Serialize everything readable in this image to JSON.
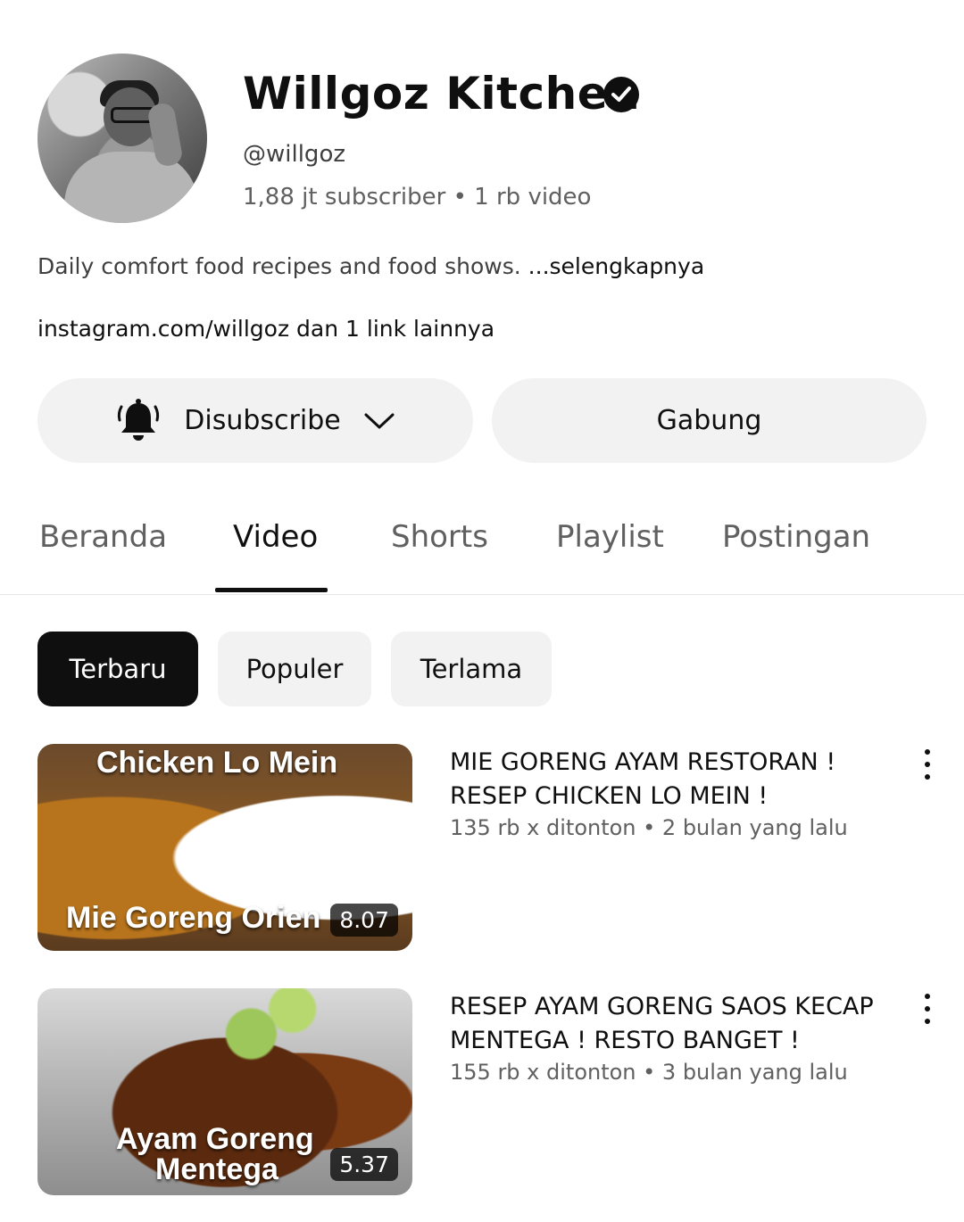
{
  "channel": {
    "name": "Willgoz Kitchen",
    "handle": "@willgoz",
    "stats": "1,88 jt subscriber • 1 rb video",
    "description": "Daily comfort food recipes and food shows. ",
    "description_more": "...selengkapnya",
    "links": "instagram.com/willgoz dan 1 link lainnya"
  },
  "buttons": {
    "subscribe_label": "Disubscribe",
    "join_label": "Gabung"
  },
  "tabs": [
    {
      "label": "Beranda",
      "active": false
    },
    {
      "label": "Video",
      "active": true
    },
    {
      "label": "Shorts",
      "active": false
    },
    {
      "label": "Playlist",
      "active": false
    },
    {
      "label": "Postingan",
      "active": false
    }
  ],
  "chips": [
    {
      "label": "Terbaru",
      "active": true
    },
    {
      "label": "Populer",
      "active": false
    },
    {
      "label": "Terlama",
      "active": false
    }
  ],
  "videos": [
    {
      "title_line1": "MIE GORENG AYAM RESTORAN !",
      "title_line2": "RESEP CHICKEN LO MEIN !",
      "meta": "135 rb x ditonton • 2 bulan yang lalu",
      "duration": "8.07",
      "thumb_text_top": "Chicken Lo Mein",
      "thumb_text_bottom": "Mie Goreng Orien"
    },
    {
      "title_line1": "RESEP AYAM GORENG SAOS KECAP",
      "title_line2": "MENTEGA ! RESTO BANGET !",
      "meta": "155 rb x ditonton • 3 bulan yang lalu",
      "duration": "5.37",
      "thumb_text_top": "Ayam Goreng",
      "thumb_text_bottom": "Mentega"
    }
  ],
  "icons": {
    "verified": "check-circle-icon",
    "bell": "bell-icon",
    "dropdown": "chevron-down-icon",
    "more": "more-vert-icon"
  }
}
